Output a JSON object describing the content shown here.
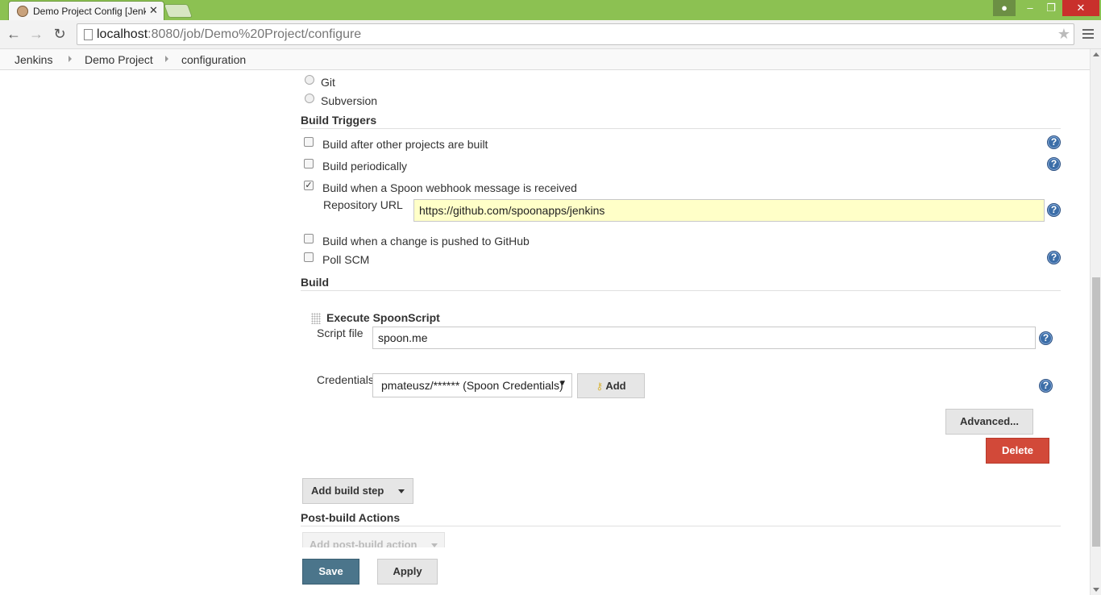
{
  "browser": {
    "tab_title": "Demo Project Config [Jenkins]",
    "url_host": "localhost",
    "url_rest": ":8080/job/Demo%20Project/configure"
  },
  "breadcrumb": [
    "Jenkins",
    "Demo Project",
    "configuration"
  ],
  "scm": {
    "options": [
      {
        "label": "Git",
        "selected": false
      },
      {
        "label": "Subversion",
        "selected": false
      }
    ]
  },
  "build_triggers": {
    "title": "Build Triggers",
    "items": [
      {
        "label": "Build after other projects are built",
        "checked": false
      },
      {
        "label": "Build periodically",
        "checked": false
      },
      {
        "label": "Build when a Spoon webhook message is received",
        "checked": true
      },
      {
        "label": "Build when a change is pushed to GitHub",
        "checked": false
      },
      {
        "label": "Poll SCM",
        "checked": false
      }
    ],
    "repository_url_label": "Repository URL",
    "repository_url_value": "https://github.com/spoonapps/jenkins"
  },
  "build": {
    "title": "Build",
    "step_title": "Execute SpoonScript",
    "script_file_label": "Script file",
    "script_file_value": "spoon.me",
    "credentials_label": "Credentials",
    "credentials_value": "pmateusz/****** (Spoon Credentials)",
    "add_label": "Add",
    "advanced_label": "Advanced...",
    "delete_label": "Delete",
    "add_build_step_label": "Add build step"
  },
  "post_build": {
    "title": "Post-build Actions",
    "add_action_label": "Add post-build action"
  },
  "footer": {
    "save_label": "Save",
    "apply_label": "Apply"
  },
  "colors": {
    "chrome_frame": "#8cc152",
    "save_button": "#4b758b",
    "delete_button": "#d24939",
    "url_field_highlight": "#ffffc8",
    "help_icon": "#3c6ea8"
  }
}
